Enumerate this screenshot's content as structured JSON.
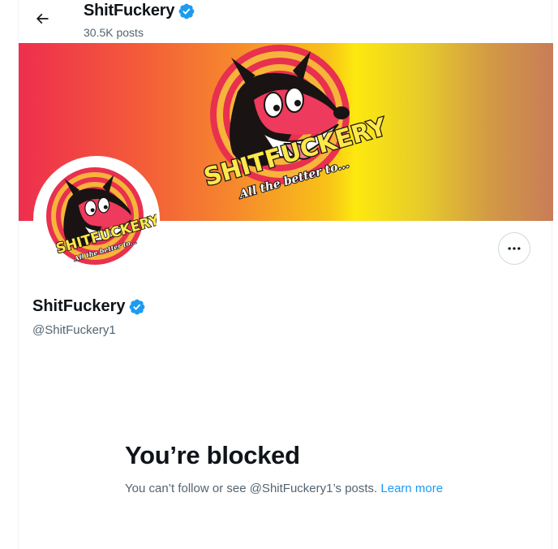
{
  "header": {
    "back_icon": "arrow-left-icon",
    "title": "ShitFuckery",
    "posts_count": "30.5K posts"
  },
  "banner": {
    "brand_text": "SHITFUCKERY",
    "tagline": "All the better to..."
  },
  "avatar": {
    "brand_text": "SHITFUCKERY",
    "tagline": "All the better to..."
  },
  "profile": {
    "name": "ShitFuckery",
    "handle": "@ShitFuckery1",
    "verified_icon": "verified-badge-icon",
    "more_icon": "more-horizontal-icon"
  },
  "blocked": {
    "title": "You’re blocked",
    "message": "You can’t follow or see @ShitFuckery1’s posts.",
    "link": "Learn more"
  },
  "colors": {
    "accent": "#1d9bf0",
    "text": "#0f1419",
    "secondary": "#536471",
    "banner_start": "#ee2e4e",
    "banner_mid": "#fde90f",
    "banner_end": "#c97c58"
  }
}
